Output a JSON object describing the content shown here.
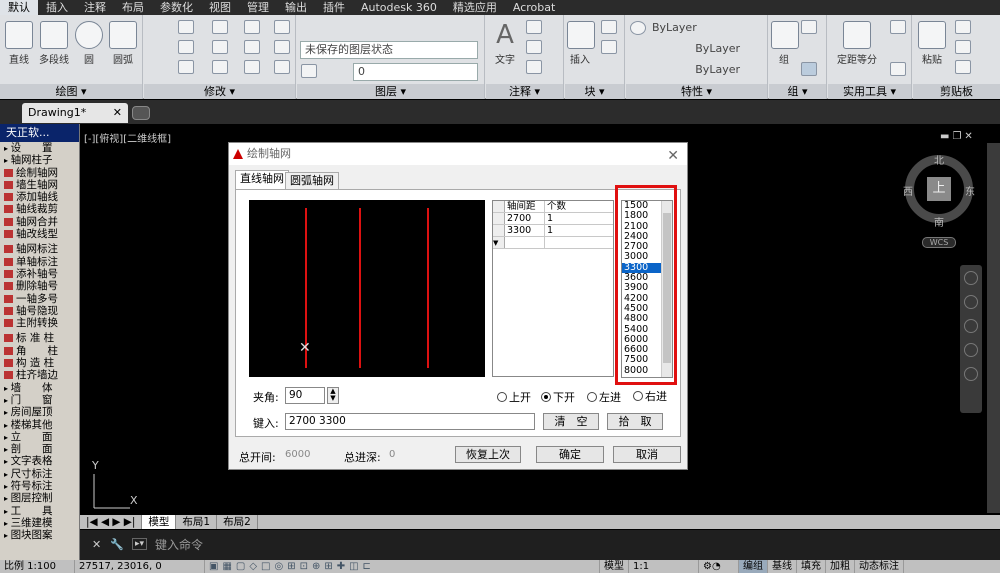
{
  "ribbon_tabs": [
    "默认",
    "插入",
    "注释",
    "布局",
    "参数化",
    "视图",
    "管理",
    "输出",
    "插件",
    "Autodesk 360",
    "精选应用",
    "Acrobat"
  ],
  "active_tab": "默认",
  "panels": {
    "draw": {
      "title": "绘图 ▾",
      "tools": [
        "直线",
        "多段线",
        "圆",
        "圆弧"
      ]
    },
    "modify": {
      "title": "修改 ▾"
    },
    "layers": {
      "title": "图层 ▾",
      "state": "未保存的图层状态",
      "current": "0"
    },
    "annotation": {
      "title": "注释 ▾",
      "text_label": "文字"
    },
    "block": {
      "title": "块 ▾",
      "insert_label": "插入"
    },
    "properties": {
      "title": "特性 ▾",
      "color": "ByLayer",
      "linetype": "ByLayer",
      "lineweight": "ByLayer"
    },
    "groups": {
      "title": "组 ▾",
      "group_label": "组"
    },
    "utilities": {
      "title": "实用工具 ▾",
      "measure_label": "定距等分"
    },
    "clipboard": {
      "title": "剪贴板",
      "paste_label": "粘贴"
    }
  },
  "document_tab": "Drawing1*",
  "palette": {
    "title": "天正软...",
    "group1": "设　　置",
    "group2": "轴网柱子",
    "axis_items": [
      "绘制轴网",
      "墙生轴网",
      "添加轴线",
      "轴线裁剪",
      "轴网合并",
      "轴改线型"
    ],
    "axis_items2": [
      "轴网标注",
      "单轴标注",
      "添补轴号",
      "删除轴号",
      "一轴多号",
      "轴号隐现",
      "主附转换"
    ],
    "column_items": [
      "标 准 柱",
      "角　　柱",
      "构 造 柱",
      "柱齐墙边"
    ],
    "groups_rest": [
      "墙　　体",
      "门　　窗",
      "房间屋顶",
      "楼梯其他",
      "立　　面",
      "剖　　面",
      "文字表格",
      "尺寸标注",
      "符号标注",
      "图层控制",
      "工　　具",
      "三维建模",
      "图块图案"
    ]
  },
  "viewport_label": "[-][俯视][二维线框]",
  "compass": {
    "north": "北",
    "south": "南",
    "east": "东",
    "west": "西",
    "top": "上",
    "wcs": "WCS"
  },
  "ucs": {
    "x": "X",
    "y": "Y"
  },
  "layout_tabs": [
    "模型",
    "布局1",
    "布局2"
  ],
  "command_prompt": "键入命令",
  "status": {
    "scale": "比例 1:100",
    "coords": "27517, 23016, 0",
    "model": "模型",
    "annoscale": "1:1",
    "toggles": [
      "编组",
      "基线",
      "填充",
      "加粗",
      "动态标注"
    ]
  },
  "dialog": {
    "title": "绘制轴网",
    "tabs": [
      "直线轴网",
      "圆弧轴网"
    ],
    "grid_headers": [
      "轴间距",
      "个数"
    ],
    "grid_rows": [
      [
        "2700",
        "1"
      ],
      [
        "3300",
        "1"
      ]
    ],
    "spacing_list": [
      "1500",
      "1800",
      "2100",
      "2400",
      "2700",
      "3000",
      "3300",
      "3600",
      "3900",
      "4200",
      "4500",
      "4800",
      "5400",
      "6000",
      "6600",
      "7500",
      "8000"
    ],
    "selected_spacing": "3300",
    "angle_label": "夹角:",
    "angle_value": "90",
    "input_label": "键入:",
    "input_value": "2700 3300",
    "radios": [
      "上开",
      "下开",
      "左进",
      "右进"
    ],
    "checked_radio": "下开",
    "clear_btn": "清　空",
    "pick_btn": "拾　取",
    "total_width_label": "总开间:",
    "total_width": "6000",
    "total_depth_label": "总进深:",
    "total_depth": "0",
    "restore_btn": "恢复上次",
    "ok_btn": "确定",
    "cancel_btn": "取消"
  },
  "colors": {
    "highlight_box": "#e01010",
    "axis_line": "#dd1111",
    "selection": "#0a64c8"
  }
}
